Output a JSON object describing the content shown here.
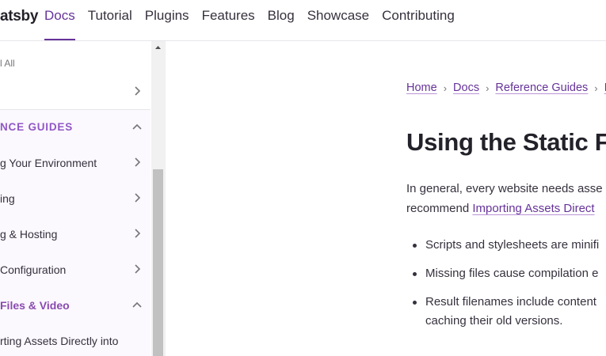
{
  "header": {
    "logo_text": "atsby",
    "nav": [
      {
        "label": "Docs",
        "active": true
      },
      {
        "label": "Tutorial",
        "active": false
      },
      {
        "label": "Plugins",
        "active": false
      },
      {
        "label": "Features",
        "active": false
      },
      {
        "label": "Blog",
        "active": false
      },
      {
        "label": "Showcase",
        "active": false
      },
      {
        "label": "Contributing",
        "active": false
      }
    ]
  },
  "sidebar": {
    "collapse_all": "l All",
    "items": [
      {
        "label": "",
        "chevron": "right"
      },
      {
        "label": "NCE GUIDES",
        "chevron": "up"
      },
      {
        "label": "g Your Environment",
        "chevron": "right"
      },
      {
        "label": "ing",
        "chevron": "right"
      },
      {
        "label": "g & Hosting",
        "chevron": "right"
      },
      {
        "label": "Configuration",
        "chevron": "right"
      },
      {
        "label": "Files & Video",
        "chevron": "up"
      },
      {
        "label": "rting Assets Directly into",
        "chevron": ""
      }
    ]
  },
  "breadcrumb": [
    "Home",
    "Docs",
    "Reference Guides",
    "Im"
  ],
  "main": {
    "title": "Using the Static Fo",
    "para_line1": "In general, every website needs asse",
    "para_line2_prefix": "recommend ",
    "para_link": "Importing Assets Direct",
    "bullets": [
      "Scripts and stylesheets are minifi",
      "Missing files cause compilation e",
      "Result filenames include content",
      "caching their old versions."
    ]
  },
  "colors": {
    "accent": "#663399",
    "section_label": "#9158c6",
    "sidebar_tint": "#fbf8fe"
  }
}
